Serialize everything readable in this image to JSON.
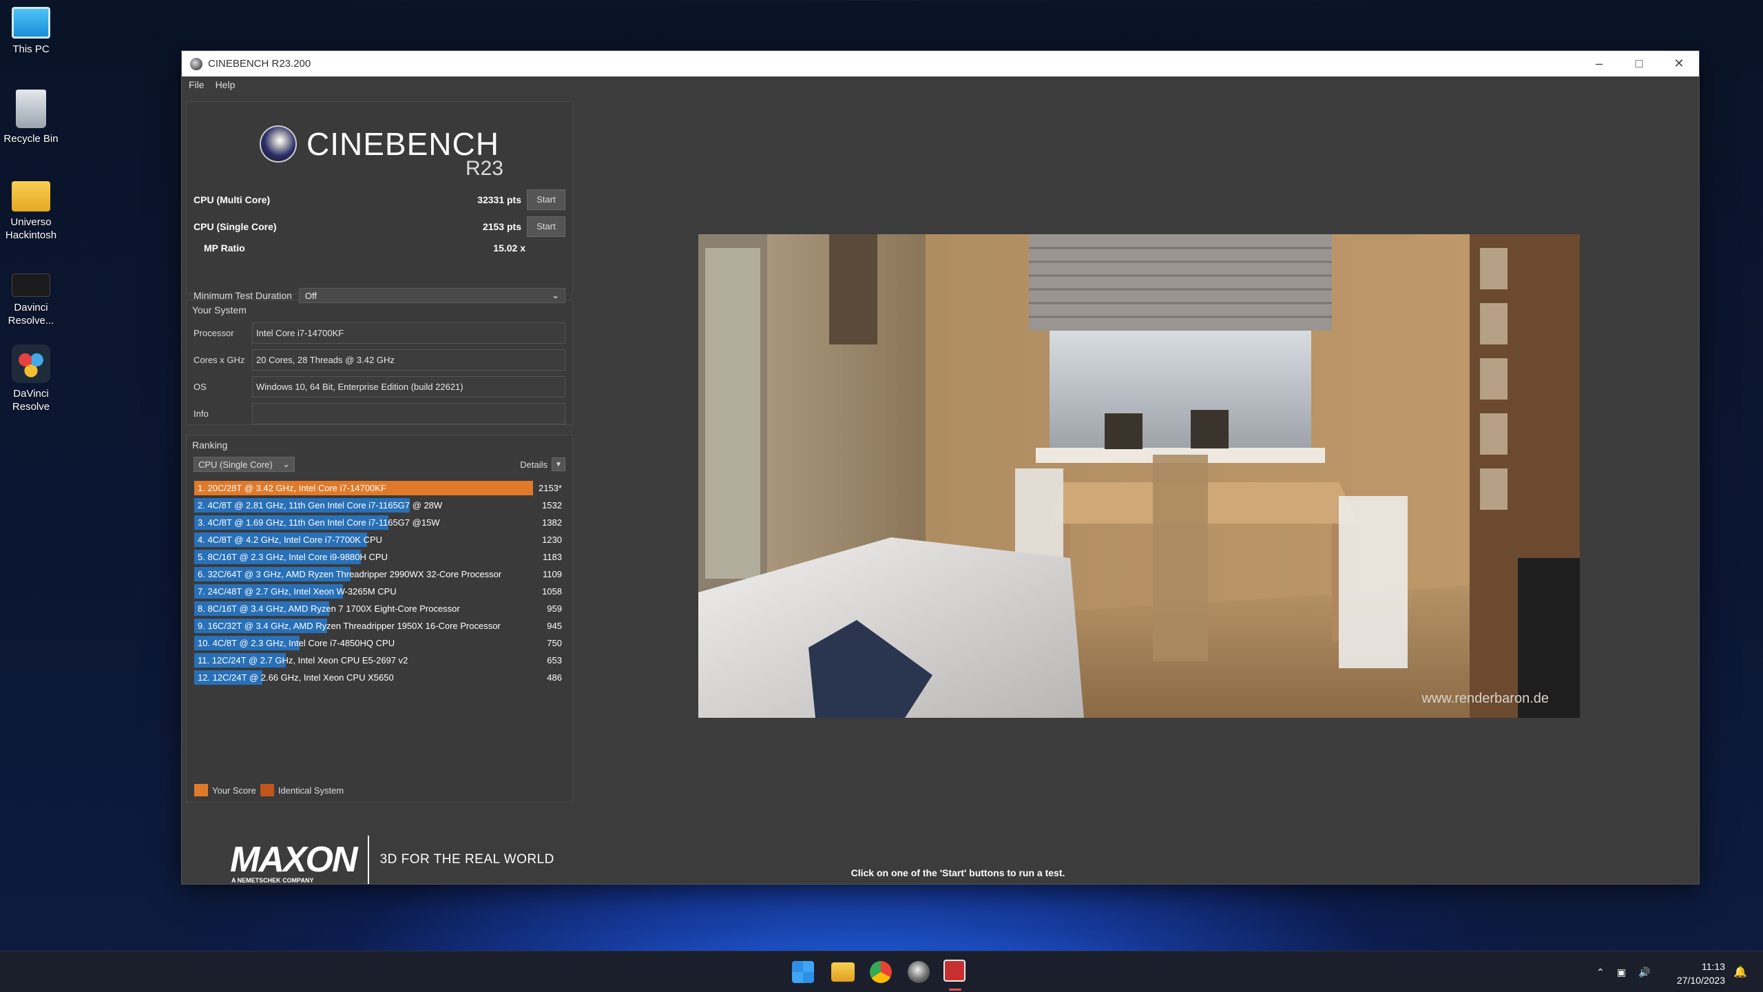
{
  "desktop": {
    "icons": [
      {
        "label": "This PC"
      },
      {
        "label": "Recycle Bin"
      },
      {
        "label": "Universo Hackintosh"
      },
      {
        "label": "Davinci Resolve..."
      },
      {
        "label": "DaVinci Resolve"
      }
    ]
  },
  "window": {
    "title": "CINEBENCH R23.200",
    "menu": [
      "File",
      "Help"
    ]
  },
  "logo": {
    "name": "CINEBENCH",
    "version": "R23"
  },
  "scores": {
    "multi": {
      "label": "CPU (Multi Core)",
      "value": "32331 pts",
      "button": "Start"
    },
    "single": {
      "label": "CPU (Single Core)",
      "value": "2153 pts",
      "button": "Start"
    },
    "mp_ratio": {
      "label": "MP Ratio",
      "value": "15.02 x"
    }
  },
  "duration": {
    "label": "Minimum Test Duration",
    "value": "Off"
  },
  "system": {
    "title": "Your System",
    "rows": [
      {
        "label": "Processor",
        "value": "Intel Core i7-14700KF"
      },
      {
        "label": "Cores x GHz",
        "value": "20 Cores, 28 Threads @ 3.42 GHz"
      },
      {
        "label": "OS",
        "value": "Windows 10, 64 Bit, Enterprise Edition (build 22621)"
      },
      {
        "label": "Info",
        "value": ""
      }
    ]
  },
  "ranking": {
    "title": "Ranking",
    "selected": "CPU (Single Core)",
    "details_label": "Details",
    "max": 2153,
    "items": [
      {
        "text": "1. 20C/28T @ 3.42 GHz, Intel Core i7-14700KF",
        "score": "2153*",
        "value": 2153,
        "top": true
      },
      {
        "text": "2. 4C/8T @ 2.81 GHz, 11th Gen Intel Core i7-1165G7 @ 28W",
        "score": "1532",
        "value": 1532
      },
      {
        "text": "3. 4C/8T @ 1.69 GHz, 11th Gen Intel Core i7-1165G7 @15W",
        "score": "1382",
        "value": 1382
      },
      {
        "text": "4. 4C/8T @ 4.2 GHz, Intel Core i7-7700K CPU",
        "score": "1230",
        "value": 1230
      },
      {
        "text": "5. 8C/16T @ 2.3 GHz, Intel Core i9-9880H CPU",
        "score": "1183",
        "value": 1183
      },
      {
        "text": "6. 32C/64T @ 3 GHz, AMD Ryzen Threadripper 2990WX 32-Core Processor",
        "score": "1109",
        "value": 1109
      },
      {
        "text": "7. 24C/48T @ 2.7 GHz, Intel Xeon W-3265M CPU",
        "score": "1058",
        "value": 1058
      },
      {
        "text": "8. 8C/16T @ 3.4 GHz, AMD Ryzen 7 1700X Eight-Core Processor",
        "score": "959",
        "value": 959
      },
      {
        "text": "9. 16C/32T @ 3.4 GHz, AMD Ryzen Threadripper 1950X 16-Core Processor",
        "score": "945",
        "value": 945
      },
      {
        "text": "10. 4C/8T @ 2.3 GHz, Intel Core i7-4850HQ CPU",
        "score": "750",
        "value": 750
      },
      {
        "text": "11. 12C/24T @ 2.7 GHz, Intel Xeon CPU E5-2697 v2",
        "score": "653",
        "value": 653
      },
      {
        "text": "12. 12C/24T @ 2.66 GHz, Intel Xeon CPU X5650",
        "score": "486",
        "value": 486
      }
    ],
    "legend": [
      {
        "label": "Your Score",
        "color": "#e07a2a"
      },
      {
        "label": "Identical System",
        "color": "#c0561a"
      }
    ]
  },
  "maxon": {
    "logo": "MAXON",
    "sub": "A NEMETSCHEK COMPANY",
    "tagline": "3D FOR THE REAL WORLD"
  },
  "render": {
    "watermark": "www.renderbaron.de"
  },
  "status": "Click on one of the 'Start' buttons to run a test.",
  "taskbar": {
    "time": "11:13",
    "date": "27/10/2023"
  },
  "colors": {
    "bar_blue": "#2870b8",
    "bar_orange": "#e07a2a"
  }
}
